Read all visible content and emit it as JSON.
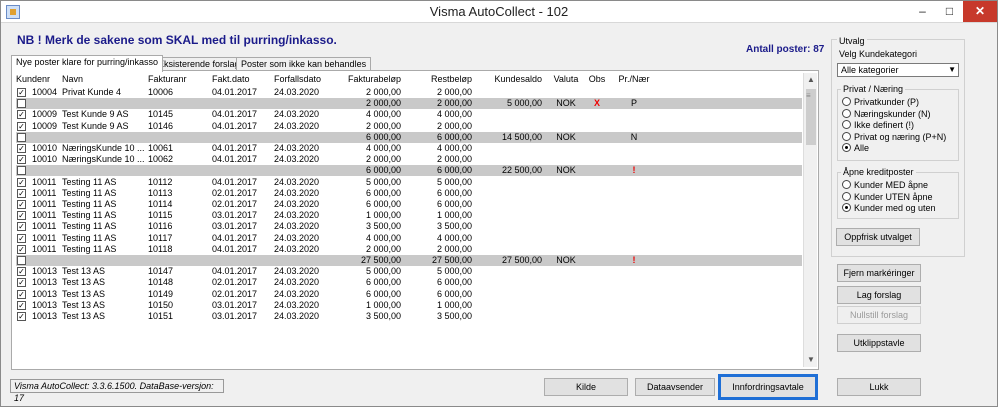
{
  "window": {
    "title": "Visma AutoCollect - 102",
    "min": "–",
    "max": "□",
    "close": "✕"
  },
  "notice": "NB ! Merk de sakene som SKAL med til purring/inkasso.",
  "count_label": "Antall poster: 87",
  "tabs": [
    "Nye poster klare for purring/inkasso",
    "Eksisterende forslag",
    "Poster som ikke kan behandles"
  ],
  "columns": [
    "Kundenr",
    "Navn",
    "Fakturanr",
    "Fakt.dato",
    "Forfallsdato",
    "Fakturabeløp",
    "Restbeløp",
    "Kundesaldo",
    "Valuta",
    "Obs",
    "Pr./Nær"
  ],
  "rows": [
    {
      "type": "item",
      "check": "✓",
      "kunde": "10004",
      "navn": "Privat Kunde 4",
      "fnr": "10006",
      "fdato": "04.01.2017",
      "forf": "24.03.2020",
      "belop": "2 000,00",
      "rest": "2 000,00"
    },
    {
      "type": "sum",
      "check": "",
      "belop": "2 000,00",
      "rest": "2 000,00",
      "saldo": "5 000,00",
      "valuta": "NOK",
      "obs": "X",
      "prn": "P"
    },
    {
      "type": "item",
      "check": "✓",
      "kunde": "10009",
      "navn": "Test Kunde 9 AS",
      "fnr": "10145",
      "fdato": "04.01.2017",
      "forf": "24.03.2020",
      "belop": "4 000,00",
      "rest": "4 000,00"
    },
    {
      "type": "item",
      "check": "✓",
      "kunde": "10009",
      "navn": "Test Kunde 9 AS",
      "fnr": "10146",
      "fdato": "04.01.2017",
      "forf": "24.03.2020",
      "belop": "2 000,00",
      "rest": "2 000,00"
    },
    {
      "type": "sum",
      "check": "",
      "belop": "6 000,00",
      "rest": "6 000,00",
      "saldo": "14 500,00",
      "valuta": "NOK",
      "obs": "",
      "prn": "N"
    },
    {
      "type": "item",
      "check": "✓",
      "kunde": "10010",
      "navn": "NæringsKunde 10 ...",
      "fnr": "10061",
      "fdato": "04.01.2017",
      "forf": "24.03.2020",
      "belop": "4 000,00",
      "rest": "4 000,00"
    },
    {
      "type": "item",
      "check": "✓",
      "kunde": "10010",
      "navn": "NæringsKunde 10 ...",
      "fnr": "10062",
      "fdato": "04.01.2017",
      "forf": "24.03.2020",
      "belop": "2 000,00",
      "rest": "2 000,00"
    },
    {
      "type": "sum",
      "check": "",
      "belop": "6 000,00",
      "rest": "6 000,00",
      "saldo": "22 500,00",
      "valuta": "NOK",
      "obs": "",
      "prn": "!"
    },
    {
      "type": "item",
      "check": "✓",
      "kunde": "10011",
      "navn": "Testing  11 AS",
      "fnr": "10112",
      "fdato": "04.01.2017",
      "forf": "24.03.2020",
      "belop": "5 000,00",
      "rest": "5 000,00"
    },
    {
      "type": "item",
      "check": "✓",
      "kunde": "10011",
      "navn": "Testing  11 AS",
      "fnr": "10113",
      "fdato": "02.01.2017",
      "forf": "24.03.2020",
      "belop": "6 000,00",
      "rest": "6 000,00"
    },
    {
      "type": "item",
      "check": "✓",
      "kunde": "10011",
      "navn": "Testing  11 AS",
      "fnr": "10114",
      "fdato": "02.01.2017",
      "forf": "24.03.2020",
      "belop": "6 000,00",
      "rest": "6 000,00"
    },
    {
      "type": "item",
      "check": "✓",
      "kunde": "10011",
      "navn": "Testing  11 AS",
      "fnr": "10115",
      "fdato": "03.01.2017",
      "forf": "24.03.2020",
      "belop": "1 000,00",
      "rest": "1 000,00"
    },
    {
      "type": "item",
      "check": "✓",
      "kunde": "10011",
      "navn": "Testing  11 AS",
      "fnr": "10116",
      "fdato": "03.01.2017",
      "forf": "24.03.2020",
      "belop": "3 500,00",
      "rest": "3 500,00"
    },
    {
      "type": "item",
      "check": "✓",
      "kunde": "10011",
      "navn": "Testing  11 AS",
      "fnr": "10117",
      "fdato": "04.01.2017",
      "forf": "24.03.2020",
      "belop": "4 000,00",
      "rest": "4 000,00"
    },
    {
      "type": "item",
      "check": "✓",
      "kunde": "10011",
      "navn": "Testing  11 AS",
      "fnr": "10118",
      "fdato": "04.01.2017",
      "forf": "24.03.2020",
      "belop": "2 000,00",
      "rest": "2 000,00"
    },
    {
      "type": "sum",
      "check": "",
      "belop": "27 500,00",
      "rest": "27 500,00",
      "saldo": "27 500,00",
      "valuta": "NOK",
      "obs": "",
      "prn": "!"
    },
    {
      "type": "item",
      "check": "✓",
      "kunde": "10013",
      "navn": "Test 13 AS",
      "fnr": "10147",
      "fdato": "04.01.2017",
      "forf": "24.03.2020",
      "belop": "5 000,00",
      "rest": "5 000,00"
    },
    {
      "type": "item",
      "check": "✓",
      "kunde": "10013",
      "navn": "Test 13 AS",
      "fnr": "10148",
      "fdato": "02.01.2017",
      "forf": "24.03.2020",
      "belop": "6 000,00",
      "rest": "6 000,00"
    },
    {
      "type": "item",
      "check": "✓",
      "kunde": "10013",
      "navn": "Test 13 AS",
      "fnr": "10149",
      "fdato": "02.01.2017",
      "forf": "24.03.2020",
      "belop": "6 000,00",
      "rest": "6 000,00"
    },
    {
      "type": "item",
      "check": "✓",
      "kunde": "10013",
      "navn": "Test 13 AS",
      "fnr": "10150",
      "fdato": "03.01.2017",
      "forf": "24.03.2020",
      "belop": "1 000,00",
      "rest": "1 000,00"
    },
    {
      "type": "item",
      "check": "✓",
      "kunde": "10013",
      "navn": "Test 13 AS",
      "fnr": "10151",
      "fdato": "03.01.2017",
      "forf": "24.03.2020",
      "belop": "3 500,00",
      "rest": "3 500,00"
    }
  ],
  "scrollbar": {
    "up": "▲",
    "down": "▼",
    "grip": "≡"
  },
  "version_text": "Visma AutoCollect: 3.3.6.1500. DataBase-versjon: 17",
  "buttons": {
    "kilde": "Kilde",
    "dataavsender": "Dataavsender",
    "innfordringsavtale": "Innfordringsavtale",
    "lukk": "Lukk",
    "oppfrisk": "Oppfrisk utvalget",
    "fjern": "Fjern markéringer",
    "lag": "Lag forslag",
    "nullstill": "Nullstill forslag",
    "utklipp": "Utklippstavle"
  },
  "utvalg": {
    "title": "Utvalg",
    "kategori_label": "Velg Kundekategori",
    "kategori_value": "Alle kategorier",
    "dropdown_arrow": "▼",
    "privat_title": "Privat / Næring",
    "privat_options": [
      "Privatkunder (P)",
      "Næringskunder (N)",
      "Ikke definert (!)",
      "Privat og næring (P+N)",
      "Alle"
    ],
    "privat_selected": 4,
    "apne_title": "Åpne kreditposter",
    "apne_options": [
      "Kunder MED åpne",
      "Kunder UTEN åpne",
      "Kunder med og uten"
    ],
    "apne_selected": 2
  }
}
